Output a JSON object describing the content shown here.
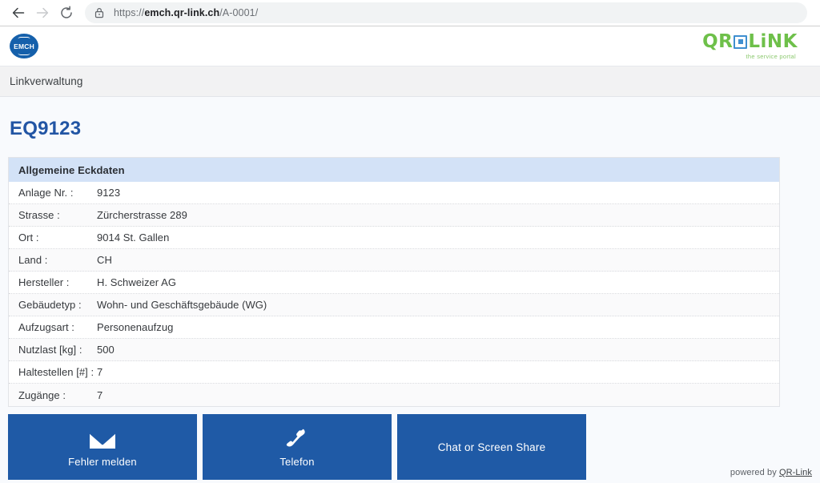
{
  "browser": {
    "back_icon": "arrow-left-icon",
    "forward_icon": "arrow-right-icon",
    "reload_icon": "reload-icon",
    "lock_icon": "lock-icon",
    "url_scheme": "https://",
    "url_domain": "emch.qr-link.ch",
    "url_path": "/A-0001/"
  },
  "site_header": {
    "brand_logo": {
      "name": "emch-logo",
      "word": "EMCH",
      "color": "#1560ab"
    },
    "portal_logo": {
      "name": "qr-link-logo",
      "text_left": "QR",
      "text_right": "LiNK",
      "tagline": "the service portal",
      "green": "#6ec04a",
      "blue": "#3f8fd0"
    }
  },
  "nav": {
    "label": "Linkverwaltung"
  },
  "main": {
    "title": "EQ9123",
    "title_color": "#2255a4",
    "card": {
      "header": "Allgemeine Eckdaten",
      "header_bg": "#d3e2f7",
      "rows": [
        {
          "label": "Anlage Nr. :",
          "value": "9123"
        },
        {
          "label": "Strasse :",
          "value": "Zürcherstrasse 289"
        },
        {
          "label": "Ort :",
          "value": "9014 St. Gallen"
        },
        {
          "label": "Land :",
          "value": "CH"
        },
        {
          "label": "Hersteller :",
          "value": "H. Schweizer AG"
        },
        {
          "label": "Gebäudetyp :",
          "value": "Wohn- und Geschäftsgebäude (WG)"
        },
        {
          "label": "Aufzugsart :",
          "value": "Personenaufzug"
        },
        {
          "label": "Nutzlast [kg] :",
          "value": "500"
        },
        {
          "label": "Haltestellen [#] :",
          "value": "7"
        },
        {
          "label": "Zugänge :",
          "value": "7"
        }
      ]
    },
    "actions": [
      {
        "label": "Fehler melden",
        "icon": "envelope-icon"
      },
      {
        "label": "Telefon",
        "icon": "phone-icon"
      },
      {
        "label": "Chat or Screen Share",
        "icon": ""
      }
    ],
    "action_color": "#1f5aa6"
  },
  "footer": {
    "prefix": "powered by ",
    "link": "QR-Link"
  }
}
